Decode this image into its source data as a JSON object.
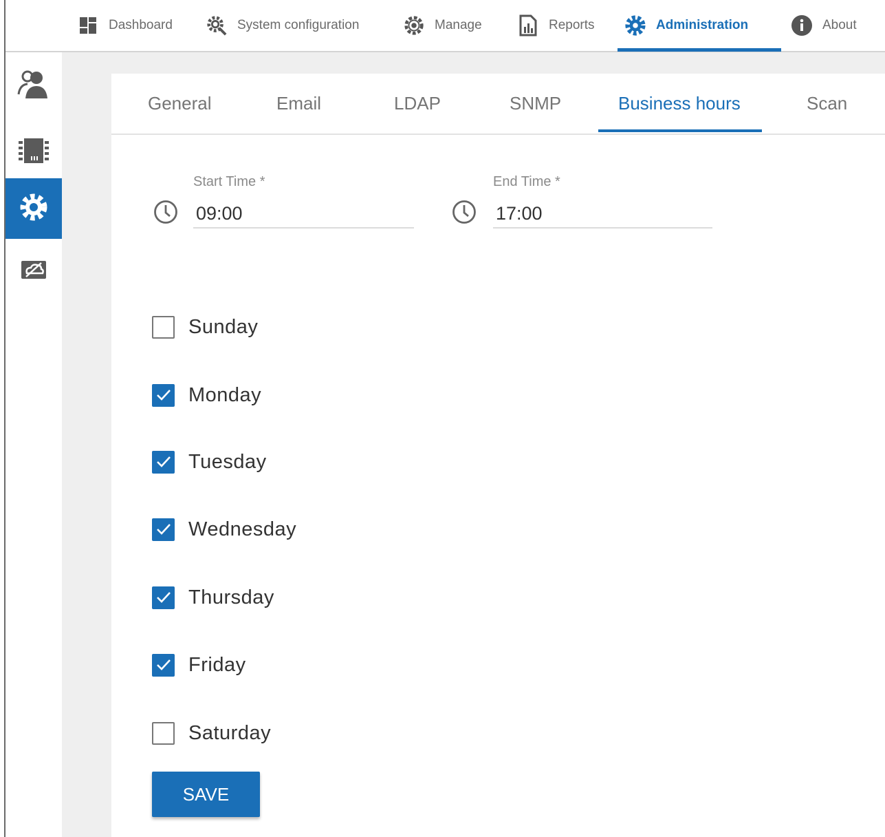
{
  "topnav": {
    "items": [
      {
        "label": "Dashboard",
        "icon": "dashboard-icon"
      },
      {
        "label": "System configuration",
        "icon": "system-configuration-icon"
      },
      {
        "label": "Manage",
        "icon": "gear-icon"
      },
      {
        "label": "Reports",
        "icon": "reports-icon"
      },
      {
        "label": "Administration",
        "icon": "admin-gear-icon",
        "active": true
      },
      {
        "label": "About",
        "icon": "info-icon"
      }
    ]
  },
  "sidebar": {
    "items": [
      {
        "icon": "users-icon"
      },
      {
        "icon": "chip-icon"
      },
      {
        "icon": "settings-icon",
        "active": true
      },
      {
        "icon": "cloud-off-icon"
      }
    ]
  },
  "tabs": [
    {
      "label": "General"
    },
    {
      "label": "Email"
    },
    {
      "label": "LDAP"
    },
    {
      "label": "SNMP"
    },
    {
      "label": "Business hours",
      "active": true
    },
    {
      "label": "Scan"
    }
  ],
  "form": {
    "start_label": "Start Time *",
    "start_value": "09:00",
    "end_label": "End Time *",
    "end_value": "17:00"
  },
  "days": [
    {
      "label": "Sunday",
      "checked": false
    },
    {
      "label": "Monday",
      "checked": true
    },
    {
      "label": "Tuesday",
      "checked": true
    },
    {
      "label": "Wednesday",
      "checked": true
    },
    {
      "label": "Thursday",
      "checked": true
    },
    {
      "label": "Friday",
      "checked": true
    },
    {
      "label": "Saturday",
      "checked": false
    }
  ],
  "save_label": "SAVE",
  "colors": {
    "accent": "#1a6fb7",
    "page_bg": "#efefef",
    "muted_text": "#757575"
  }
}
